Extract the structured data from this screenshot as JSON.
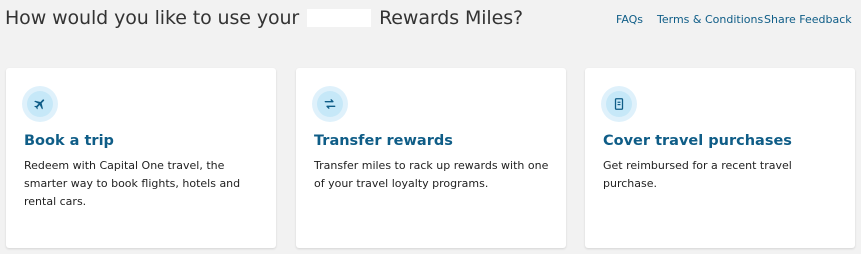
{
  "header": {
    "title_prefix": "How would you like to use your",
    "title_suffix": "Rewards Miles?",
    "links": [
      {
        "label": "FAQs"
      },
      {
        "label": "Terms & Conditions"
      },
      {
        "label": "Share Feedback"
      }
    ]
  },
  "cards": [
    {
      "icon": "airplane-icon",
      "title": "Book a trip",
      "description": "Redeem with Capital One travel, the smarter way to book flights, hotels and rental cars."
    },
    {
      "icon": "transfer-arrows-icon",
      "title": "Transfer rewards",
      "description": "Transfer miles to rack up rewards with one of your travel loyalty programs."
    },
    {
      "icon": "receipt-icon",
      "title": "Cover travel purchases",
      "description": "Get reimbursed for a recent travel purchase."
    }
  ],
  "colors": {
    "background": "#f2f2f2",
    "accent": "#0f5d87",
    "icon_bg": "#dff1fb"
  }
}
